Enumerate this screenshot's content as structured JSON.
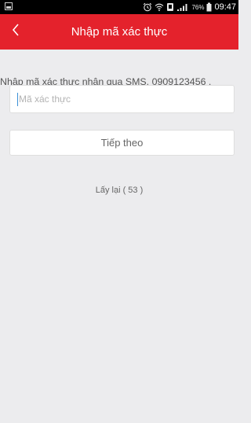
{
  "status_bar": {
    "battery_percent": "76%",
    "time": "09:47"
  },
  "header": {
    "title": "Nhập mã xác thực",
    "back_icon": "chevron-left-icon"
  },
  "main": {
    "instruction": "Nhập mã xác thực nhận qua SMS. 0909123456 .",
    "code_input": {
      "placeholder": "Mã xác thực",
      "value": ""
    },
    "next_button": "Tiếp theo",
    "resend_label": "Lấy lại ( 53 )"
  },
  "colors": {
    "header": "#e4222c",
    "background": "#ececee",
    "caret": "#3a8fd6"
  }
}
